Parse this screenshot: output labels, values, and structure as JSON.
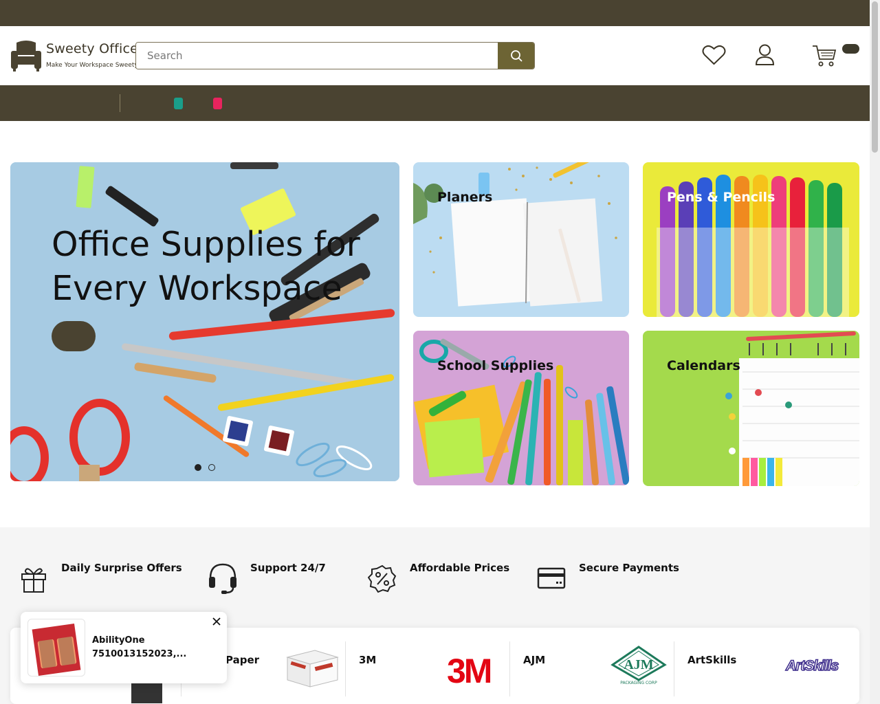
{
  "brand": {
    "name": "Sweety Office",
    "tagline": "Make Your Workspace Sweety"
  },
  "search": {
    "placeholder": "Search",
    "icon": "search-icon"
  },
  "header_icons": [
    "heart-icon",
    "user-icon",
    "cart-icon"
  ],
  "nav": {
    "dot_colors": [
      "#1a9e8a",
      "#e8245e"
    ]
  },
  "hero": {
    "title": "Office Supplies for Every Workspace",
    "slide_count": 2,
    "active_slide": 1
  },
  "categories": [
    {
      "label": "Planers"
    },
    {
      "label": "Pens & Pencils"
    },
    {
      "label": "School Supplies"
    },
    {
      "label": "Calendars"
    }
  ],
  "features": [
    {
      "label": "Daily Surprise Offers",
      "icon": "gift-icon"
    },
    {
      "label": "Support 24/7",
      "icon": "headset-icon"
    },
    {
      "label": "Affordable Prices",
      "icon": "discount-icon"
    },
    {
      "label": "Secure Payments",
      "icon": "credit-card-icon"
    }
  ],
  "brands": [
    {
      "name": "Paper"
    },
    {
      "name": "3M",
      "logo_text": "3M"
    },
    {
      "name": "AJM",
      "logo_text": "AJM",
      "logo_sub": "PACKAGING CORP"
    },
    {
      "name": "ArtSkills",
      "logo_text": "ArtSkills"
    }
  ],
  "popup": {
    "product": "AbilityOne 7510013152023,..."
  },
  "colors": {
    "primary_dark": "#4a4331",
    "search_button": "#6d6434",
    "features_bg": "#f5f5f5"
  }
}
